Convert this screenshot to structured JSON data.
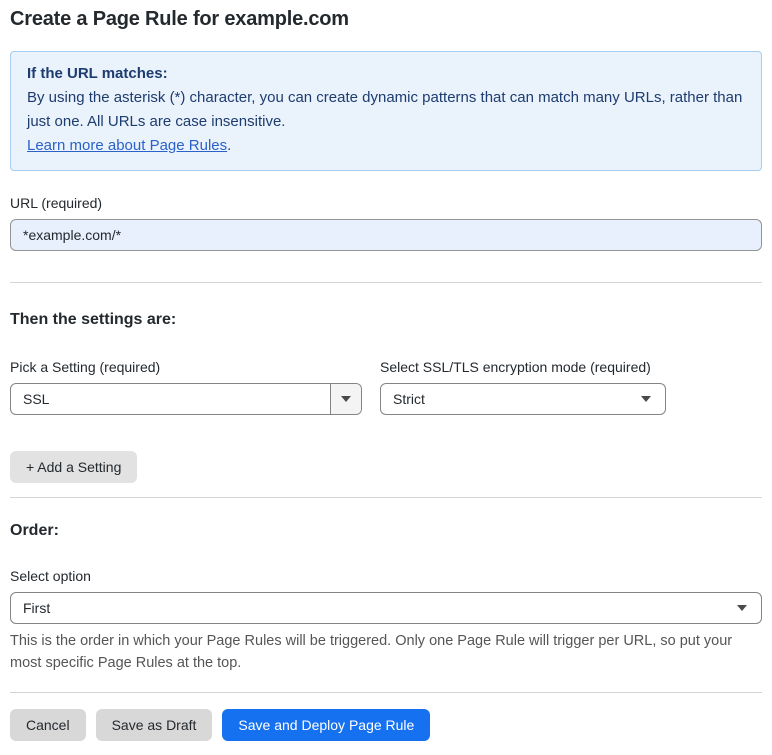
{
  "page": {
    "title": "Create a Page Rule for example.com"
  },
  "info_box": {
    "heading": "If the URL matches:",
    "body": "By using the asterisk (*) character, you can create dynamic patterns that can match many URLs, rather than just one. All URLs are case insensitive.",
    "link_label": "Learn more about Page Rules",
    "link_suffix": "."
  },
  "url_field": {
    "label": "URL (required)",
    "value": "*example.com/*"
  },
  "settings_section": {
    "heading": "Then the settings are:",
    "setting_select": {
      "label": "Pick a Setting (required)",
      "value": "SSL"
    },
    "mode_select": {
      "label": "Select SSL/TLS encryption mode (required)",
      "value": "Strict"
    },
    "add_setting_label": "+ Add a Setting"
  },
  "order_section": {
    "heading": "Order:",
    "select_label": "Select option",
    "value": "First",
    "help_text": "This is the order in which your Page Rules will be triggered. Only one Page Rule will trigger per URL, so put your most specific Page Rules at the top."
  },
  "footer": {
    "cancel_label": "Cancel",
    "save_draft_label": "Save as Draft",
    "save_deploy_label": "Save and Deploy Page Rule"
  },
  "colors": {
    "accent_blue": "#1671f0",
    "info_box_bg": "#eaf2fc",
    "info_box_border": "#a9cdee",
    "info_text": "#1d3c6f",
    "link_blue": "#2b62c9",
    "input_bg": "#e8f0fe",
    "button_gray": "#d8d8d8"
  },
  "icons": {
    "dropdown_arrow": "caret-down-icon"
  }
}
